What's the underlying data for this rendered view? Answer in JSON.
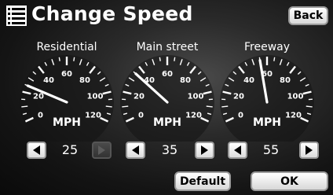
{
  "header": {
    "title": "Change Speed",
    "back_label": "Back"
  },
  "gauges": [
    {
      "label": "Residential",
      "speed": 25,
      "unit": "MPH",
      "ticks": [
        "0",
        "20",
        "40",
        "60",
        "80",
        "100",
        "120"
      ],
      "decrease_enabled": true,
      "increase_enabled": false
    },
    {
      "label": "Main street",
      "speed": 35,
      "unit": "MPH",
      "ticks": [
        "0",
        "20",
        "40",
        "60",
        "80",
        "100",
        "120"
      ],
      "decrease_enabled": true,
      "increase_enabled": true
    },
    {
      "label": "Freeway",
      "speed": 55,
      "unit": "MPH",
      "ticks": [
        "0",
        "20",
        "40",
        "60",
        "80",
        "100",
        "120"
      ],
      "decrease_enabled": true,
      "increase_enabled": true
    }
  ],
  "footer": {
    "default_label": "Default",
    "ok_label": "OK"
  },
  "icons": {
    "title": "menu-list-icon",
    "decrease": "left-arrow-icon",
    "increase": "right-arrow-icon"
  },
  "colors": {
    "background": "#2a2a2a",
    "needle": "#ffffff",
    "button_face": "#ffffff",
    "button_border": "#9a9a9a",
    "disabled_button": "#3c3c3c"
  }
}
